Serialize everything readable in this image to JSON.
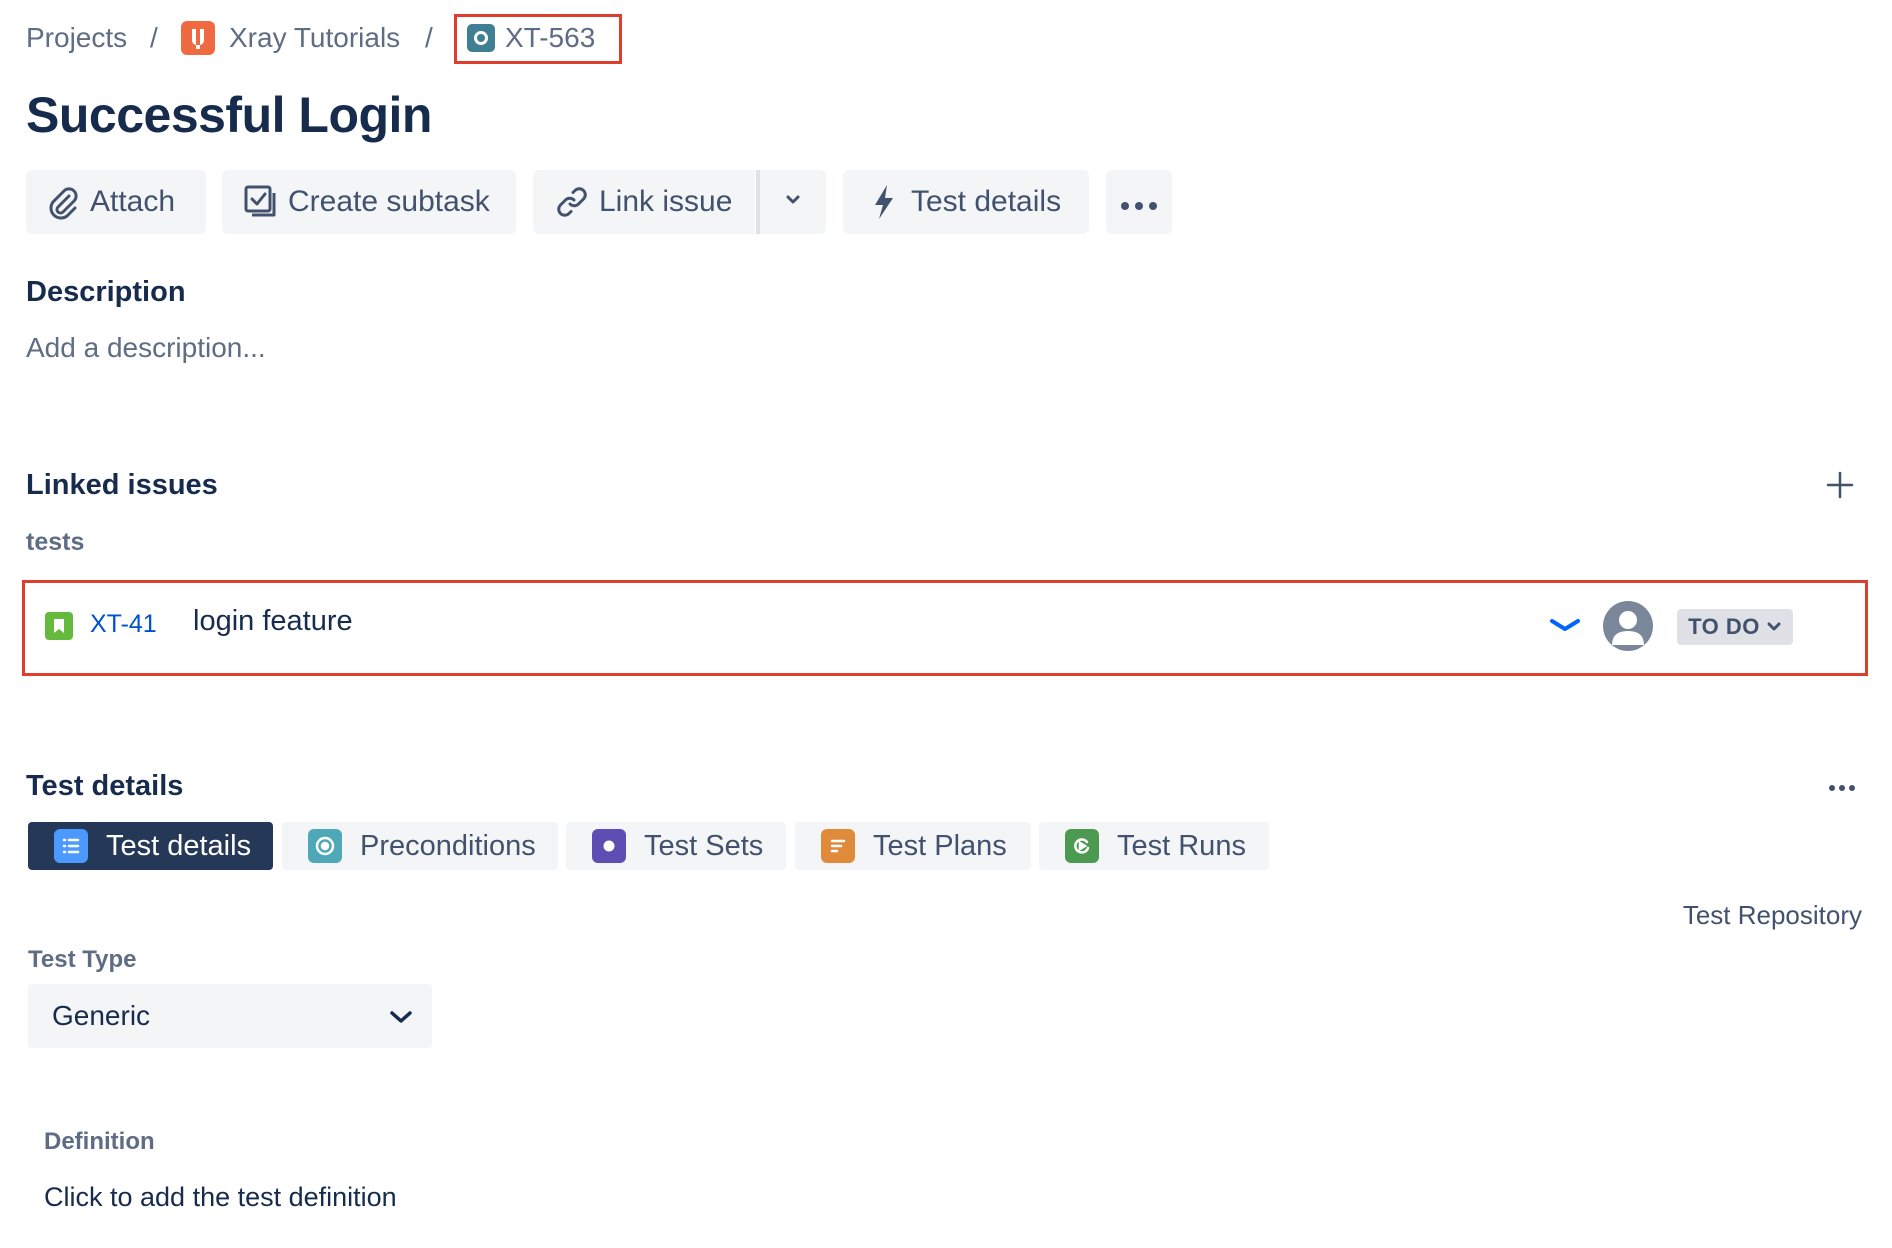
{
  "breadcrumb": {
    "projects": "Projects",
    "separator": "/",
    "project_name": "Xray Tutorials",
    "project_icon": "xray-project-icon",
    "issue_key": "XT-563",
    "issue_icon": "test-issue-icon"
  },
  "issue": {
    "title": "Successful Login"
  },
  "toolbar": {
    "attach_label": "Attach",
    "create_subtask_label": "Create subtask",
    "link_issue_label": "Link issue",
    "test_details_label": "Test details",
    "more_icon": "more-horizontal-icon"
  },
  "description": {
    "heading": "Description",
    "placeholder": "Add a description..."
  },
  "linked_issues": {
    "heading": "Linked issues",
    "relation": "tests",
    "items": [
      {
        "key": "XT-41",
        "summary": "login feature",
        "status": "TO DO",
        "type_icon": "story-icon",
        "priority_icon": "low-priority-icon"
      }
    ]
  },
  "test_details": {
    "heading": "Test details",
    "tabs": [
      {
        "label": "Test details",
        "icon": "test-details-icon",
        "color": "#4c9aff"
      },
      {
        "label": "Preconditions",
        "icon": "preconditions-icon",
        "color": "#4fa8b8"
      },
      {
        "label": "Test Sets",
        "icon": "test-sets-icon",
        "color": "#5e4db2"
      },
      {
        "label": "Test Plans",
        "icon": "test-plans-icon",
        "color": "#e08a3b"
      },
      {
        "label": "Test Runs",
        "icon": "test-runs-icon",
        "color": "#4c9a52"
      }
    ],
    "repository_link": "Test Repository",
    "test_type_label": "Test Type",
    "test_type_value": "Generic",
    "definition_label": "Definition",
    "definition_placeholder": "Click to add the test definition"
  },
  "colors": {
    "highlight": "#e03e2d",
    "link": "#0052cc",
    "active_tab": "#253858",
    "text": "#172b4d"
  }
}
